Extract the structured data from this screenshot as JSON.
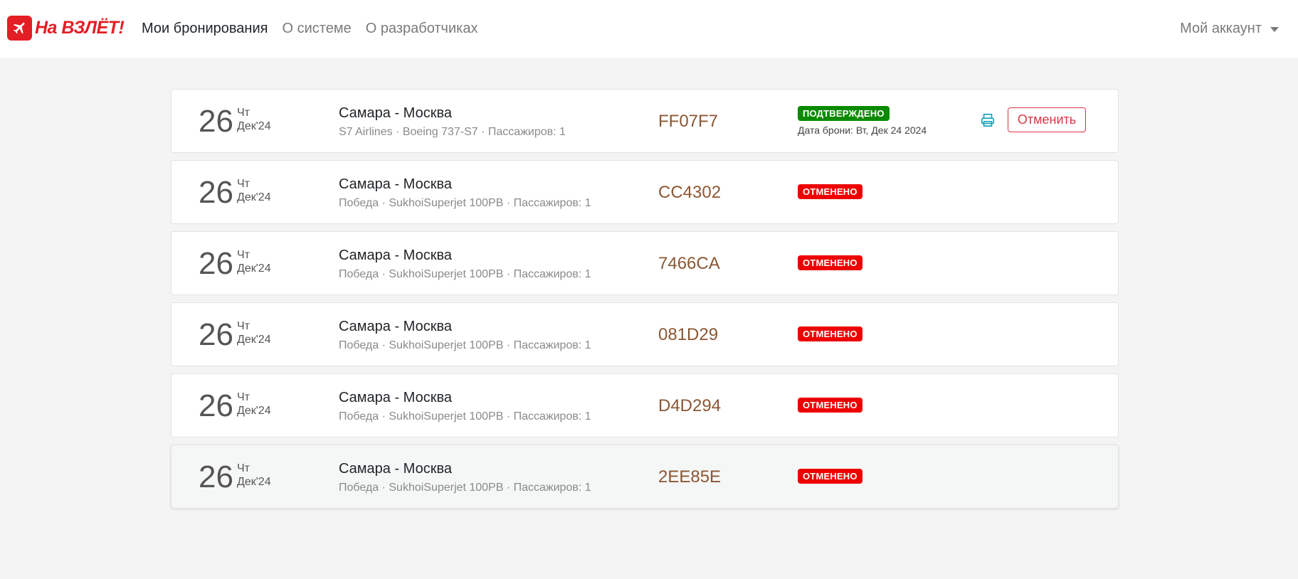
{
  "brand": {
    "name": "На ВЗЛЁТ!",
    "color": "#e31e24"
  },
  "nav": {
    "links": [
      {
        "label": "Мои бронирования",
        "active": true
      },
      {
        "label": "О системе",
        "active": false
      },
      {
        "label": "О разработчиках",
        "active": false
      }
    ],
    "account_label": "Мой аккаунт"
  },
  "bookings": [
    {
      "day": "26",
      "dow": "Чт",
      "month": "Дек'24",
      "route": "Самара - Москва",
      "meta": "S7 Airlines · Boeing 737-S7 · Пассажиров: 1",
      "code": "FF07F7",
      "status": "ПОДТВЕРЖДЕНО",
      "booking_date": "Дата брони: Вт, Дек 24 2024",
      "cancel_label": "Отменить"
    },
    {
      "day": "26",
      "dow": "Чт",
      "month": "Дек'24",
      "route": "Самара - Москва",
      "meta": "Победа · SukhoiSuperjet 100PB · Пассажиров: 1",
      "code": "CC4302",
      "status": "ОТМЕНЕНО"
    },
    {
      "day": "26",
      "dow": "Чт",
      "month": "Дек'24",
      "route": "Самара - Москва",
      "meta": "Победа · SukhoiSuperjet 100PB · Пассажиров: 1",
      "code": "7466CA",
      "status": "ОТМЕНЕНО"
    },
    {
      "day": "26",
      "dow": "Чт",
      "month": "Дек'24",
      "route": "Самара - Москва",
      "meta": "Победа · SukhoiSuperjet 100PB · Пассажиров: 1",
      "code": "081D29",
      "status": "ОТМЕНЕНО"
    },
    {
      "day": "26",
      "dow": "Чт",
      "month": "Дек'24",
      "route": "Самара - Москва",
      "meta": "Победа · SukhoiSuperjet 100PB · Пассажиров: 1",
      "code": "D4D294",
      "status": "ОТМЕНЕНО"
    },
    {
      "day": "26",
      "dow": "Чт",
      "month": "Дек'24",
      "route": "Самара - Москва",
      "meta": "Победа · SukhoiSuperjet 100PB · Пассажиров: 1",
      "code": "2EE85E",
      "status": "ОТМЕНЕНО"
    }
  ],
  "colors": {
    "confirmed": "#0b8a00",
    "cancelled": "#ee0000",
    "code": "#8b5733",
    "cancel_button": "#dc3545",
    "print_icon": "#17a2b8"
  },
  "icons": {
    "brand": "airplane-icon",
    "print": "printer-icon",
    "account": "caret-down-icon"
  }
}
